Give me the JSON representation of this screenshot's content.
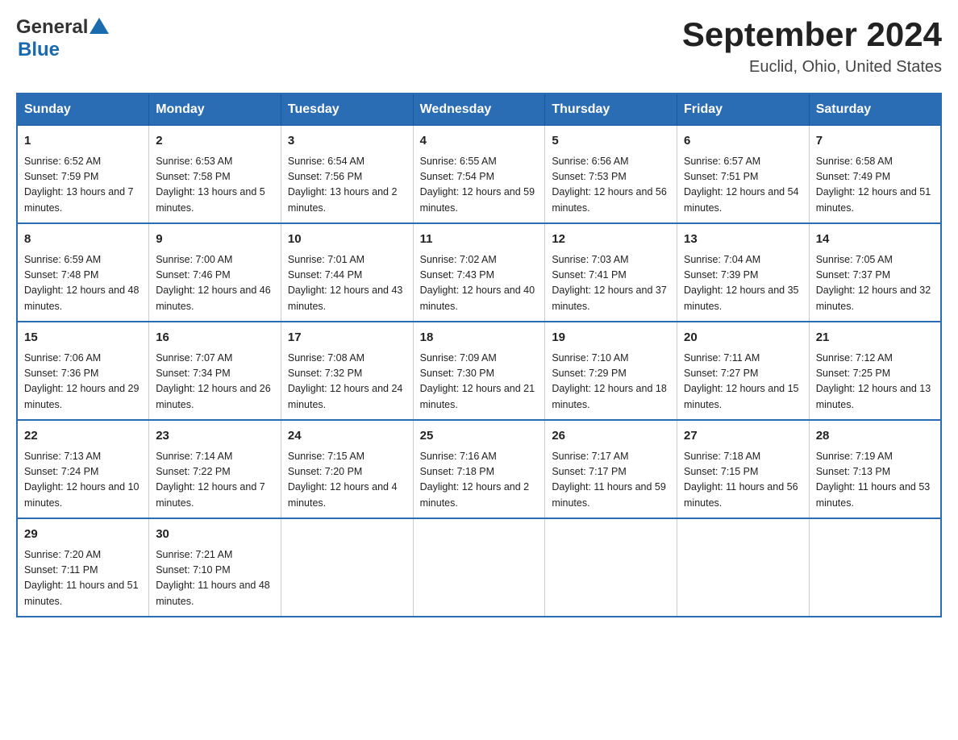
{
  "header": {
    "logo": {
      "text1": "General",
      "text2": "Blue"
    },
    "title": "September 2024",
    "subtitle": "Euclid, Ohio, United States"
  },
  "weekdays": [
    "Sunday",
    "Monday",
    "Tuesday",
    "Wednesday",
    "Thursday",
    "Friday",
    "Saturday"
  ],
  "weeks": [
    [
      {
        "day": "1",
        "sunrise": "6:52 AM",
        "sunset": "7:59 PM",
        "daylight": "13 hours and 7 minutes."
      },
      {
        "day": "2",
        "sunrise": "6:53 AM",
        "sunset": "7:58 PM",
        "daylight": "13 hours and 5 minutes."
      },
      {
        "day": "3",
        "sunrise": "6:54 AM",
        "sunset": "7:56 PM",
        "daylight": "13 hours and 2 minutes."
      },
      {
        "day": "4",
        "sunrise": "6:55 AM",
        "sunset": "7:54 PM",
        "daylight": "12 hours and 59 minutes."
      },
      {
        "day": "5",
        "sunrise": "6:56 AM",
        "sunset": "7:53 PM",
        "daylight": "12 hours and 56 minutes."
      },
      {
        "day": "6",
        "sunrise": "6:57 AM",
        "sunset": "7:51 PM",
        "daylight": "12 hours and 54 minutes."
      },
      {
        "day": "7",
        "sunrise": "6:58 AM",
        "sunset": "7:49 PM",
        "daylight": "12 hours and 51 minutes."
      }
    ],
    [
      {
        "day": "8",
        "sunrise": "6:59 AM",
        "sunset": "7:48 PM",
        "daylight": "12 hours and 48 minutes."
      },
      {
        "day": "9",
        "sunrise": "7:00 AM",
        "sunset": "7:46 PM",
        "daylight": "12 hours and 46 minutes."
      },
      {
        "day": "10",
        "sunrise": "7:01 AM",
        "sunset": "7:44 PM",
        "daylight": "12 hours and 43 minutes."
      },
      {
        "day": "11",
        "sunrise": "7:02 AM",
        "sunset": "7:43 PM",
        "daylight": "12 hours and 40 minutes."
      },
      {
        "day": "12",
        "sunrise": "7:03 AM",
        "sunset": "7:41 PM",
        "daylight": "12 hours and 37 minutes."
      },
      {
        "day": "13",
        "sunrise": "7:04 AM",
        "sunset": "7:39 PM",
        "daylight": "12 hours and 35 minutes."
      },
      {
        "day": "14",
        "sunrise": "7:05 AM",
        "sunset": "7:37 PM",
        "daylight": "12 hours and 32 minutes."
      }
    ],
    [
      {
        "day": "15",
        "sunrise": "7:06 AM",
        "sunset": "7:36 PM",
        "daylight": "12 hours and 29 minutes."
      },
      {
        "day": "16",
        "sunrise": "7:07 AM",
        "sunset": "7:34 PM",
        "daylight": "12 hours and 26 minutes."
      },
      {
        "day": "17",
        "sunrise": "7:08 AM",
        "sunset": "7:32 PM",
        "daylight": "12 hours and 24 minutes."
      },
      {
        "day": "18",
        "sunrise": "7:09 AM",
        "sunset": "7:30 PM",
        "daylight": "12 hours and 21 minutes."
      },
      {
        "day": "19",
        "sunrise": "7:10 AM",
        "sunset": "7:29 PM",
        "daylight": "12 hours and 18 minutes."
      },
      {
        "day": "20",
        "sunrise": "7:11 AM",
        "sunset": "7:27 PM",
        "daylight": "12 hours and 15 minutes."
      },
      {
        "day": "21",
        "sunrise": "7:12 AM",
        "sunset": "7:25 PM",
        "daylight": "12 hours and 13 minutes."
      }
    ],
    [
      {
        "day": "22",
        "sunrise": "7:13 AM",
        "sunset": "7:24 PM",
        "daylight": "12 hours and 10 minutes."
      },
      {
        "day": "23",
        "sunrise": "7:14 AM",
        "sunset": "7:22 PM",
        "daylight": "12 hours and 7 minutes."
      },
      {
        "day": "24",
        "sunrise": "7:15 AM",
        "sunset": "7:20 PM",
        "daylight": "12 hours and 4 minutes."
      },
      {
        "day": "25",
        "sunrise": "7:16 AM",
        "sunset": "7:18 PM",
        "daylight": "12 hours and 2 minutes."
      },
      {
        "day": "26",
        "sunrise": "7:17 AM",
        "sunset": "7:17 PM",
        "daylight": "11 hours and 59 minutes."
      },
      {
        "day": "27",
        "sunrise": "7:18 AM",
        "sunset": "7:15 PM",
        "daylight": "11 hours and 56 minutes."
      },
      {
        "day": "28",
        "sunrise": "7:19 AM",
        "sunset": "7:13 PM",
        "daylight": "11 hours and 53 minutes."
      }
    ],
    [
      {
        "day": "29",
        "sunrise": "7:20 AM",
        "sunset": "7:11 PM",
        "daylight": "11 hours and 51 minutes."
      },
      {
        "day": "30",
        "sunrise": "7:21 AM",
        "sunset": "7:10 PM",
        "daylight": "11 hours and 48 minutes."
      },
      null,
      null,
      null,
      null,
      null
    ]
  ]
}
